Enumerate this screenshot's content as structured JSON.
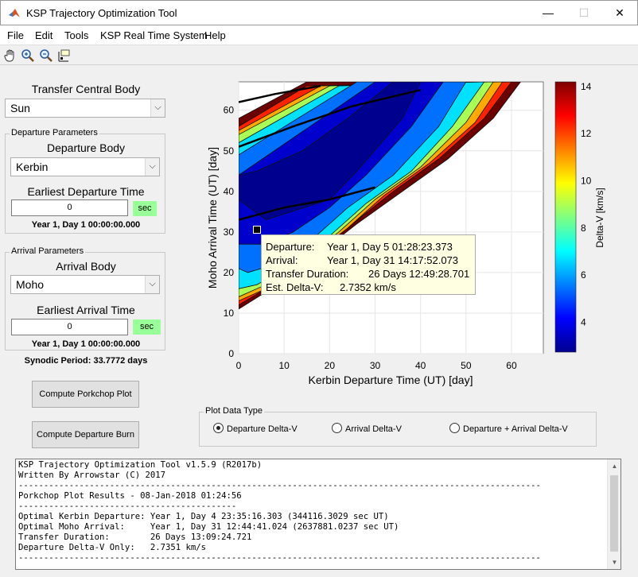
{
  "window": {
    "title": "KSP Trajectory Optimization Tool",
    "minimize": "—",
    "maximize": "☐",
    "close": "✕"
  },
  "menu": {
    "file": "File",
    "edit": "Edit",
    "tools": "Tools",
    "realtime": "KSP Real Time System",
    "help": "Help"
  },
  "toolbar": {
    "icons": [
      "pan-hand-icon",
      "zoom-in-icon",
      "zoom-out-icon",
      "data-cursor-icon"
    ]
  },
  "central": {
    "label": "Transfer Central Body",
    "value": "Sun"
  },
  "departure": {
    "group_title": "Departure Parameters",
    "body_label": "Departure Body",
    "body_value": "Kerbin",
    "time_label": "Earliest Departure Time",
    "time_value": "0",
    "unit": "sec",
    "date_text": "Year 1, Day 1 00:00:00.000"
  },
  "arrival": {
    "group_title": "Arrival Parameters",
    "body_label": "Arrival Body",
    "body_value": "Moho",
    "time_label": "Earliest Arrival Time",
    "time_value": "0",
    "unit": "sec",
    "date_text": "Year 1, Day 1 00:00:00.000"
  },
  "synodic": "Synodic Period: 33.7772 days",
  "buttons": {
    "porkchop": "Compute Porkchop Plot",
    "burn": "Compute Departure Burn"
  },
  "plot_type": {
    "title": "Plot Data Type",
    "options": [
      "Departure Delta-V",
      "Arrival Delta-V",
      "Departure + Arrival Delta-V"
    ],
    "selected": 0
  },
  "chart_data": {
    "type": "heatmap",
    "xlabel": "Kerbin Departure Time (UT) [day]",
    "ylabel": "Moho Arrival Time (UT) [day]",
    "xlim": [
      0,
      67
    ],
    "ylim": [
      0,
      67
    ],
    "x_ticks": [
      "0",
      "10",
      "20",
      "30",
      "40",
      "50",
      "60"
    ],
    "y_ticks": [
      "0",
      "10",
      "20",
      "30",
      "40",
      "50",
      "60"
    ],
    "colorbar": {
      "label": "Delta-V [km/s]",
      "range": [
        2.73,
        14.2
      ],
      "ticks": [
        "4",
        "6",
        "8",
        "10",
        "12",
        "14"
      ]
    },
    "datatip": {
      "rows": [
        [
          "Departure:",
          "Year 1, Day 5 01:28:23.373"
        ],
        [
          "Arrival:",
          "Year 1, Day 31 14:17:52.073"
        ],
        [
          "Transfer Duration:",
          "26 Days 12:49:28.701"
        ],
        [
          "Est. Delta-V:",
          "2.7352 km/s"
        ]
      ]
    },
    "grid": true
  },
  "console_lines": [
    "KSP Trajectory Optimization Tool v1.5.9 (R2017b)",
    "Written By Arrowstar (C) 2017",
    "-------------------------------------------------------------------------------------------------------",
    "Porkchop Plot Results - 08-Jan-2018 01:24:56",
    "-------------------------------------------",
    "Optimal Kerbin Departure: Year 1, Day 4 23:35:16.303 (344116.3029 sec UT)",
    "Optimal Moho Arrival:     Year 1, Day 31 12:44:41.024 (2637881.0237 sec UT)",
    "Transfer Duration:        26 Days 13:09:24.721",
    "Departure Delta-V Only:   2.7351 km/s",
    "-------------------------------------------------------------------------------------------------------"
  ]
}
